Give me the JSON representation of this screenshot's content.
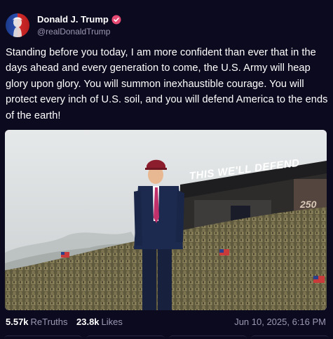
{
  "author": {
    "display_name": "Donald J. Trump",
    "handle": "@realDonaldTrump",
    "verified": true,
    "avatar_icon": "avatar-portrait",
    "verified_icon": "verified-badge-icon",
    "verified_color": "#e64a73"
  },
  "post": {
    "text": "Standing before you today, I am more confident than ever that in the days ahead and every generation to come, the U.S. Army will heap glory upon glory. You will summon inexhaustible courage. You will protect every inch of U.S. soil, and you will defend America to the ends of the earth!",
    "media": {
      "banner_text": "THIS WE'LL DEFEND",
      "screen_text": "250"
    }
  },
  "stats": {
    "retruths_count": "5.57k",
    "retruths_label": "ReTruths",
    "likes_count": "23.8k",
    "likes_label": "Likes",
    "timestamp": "Jun 10, 2025, 6:16 PM"
  },
  "colors": {
    "background": "#0c0a1f",
    "muted_text": "#9b97b3"
  }
}
